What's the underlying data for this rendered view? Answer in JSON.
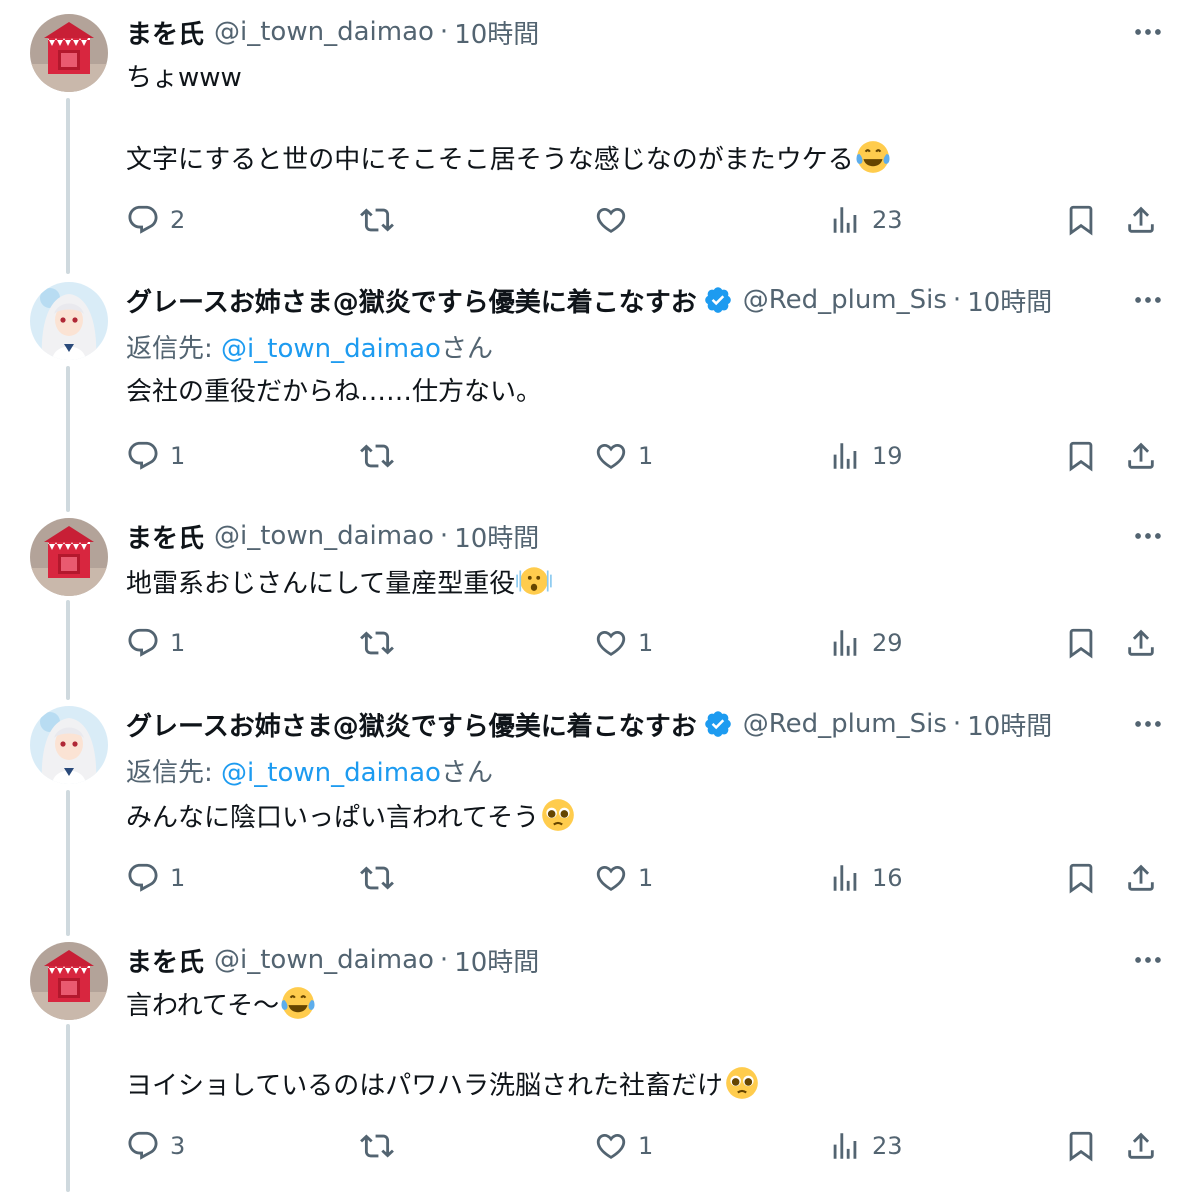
{
  "tweets": [
    {
      "author": "まを氏",
      "handle": "@i_town_daimao",
      "sep": "·",
      "time": "10時間",
      "verified": false,
      "avatar": "red-house-avatar",
      "lines": [
        "ちょwww",
        "",
        "文字にすると世の中にそこそこ居そうな感じなのがまたウケる"
      ],
      "line_emojis": [
        "",
        "",
        "laughing-crying-emoji"
      ],
      "replies": "2",
      "retweets": "",
      "likes": "",
      "views": "23"
    },
    {
      "author": "グレースお姉さま@獄炎ですら優美に着こなすお",
      "handle": "@Red_plum_Sis",
      "sep": "·",
      "time": "10時間",
      "verified": true,
      "avatar": "anime-girl-avatar",
      "reply_to_prefix": "返信先: ",
      "reply_to_user": "@i_town_daimao",
      "reply_to_suffix": "さん",
      "lines": [
        "会社の重役だからね……仕方ない。"
      ],
      "line_emojis": [
        ""
      ],
      "replies": "1",
      "retweets": "",
      "likes": "1",
      "views": "19"
    },
    {
      "author": "まを氏",
      "handle": "@i_town_daimao",
      "sep": "·",
      "time": "10時間",
      "verified": false,
      "avatar": "red-house-avatar",
      "lines": [
        "地雷系おじさんにして量産型重役"
      ],
      "line_emojis": [
        "shaking-face-emoji"
      ],
      "replies": "1",
      "retweets": "",
      "likes": "1",
      "views": "29"
    },
    {
      "author": "グレースお姉さま@獄炎ですら優美に着こなすお",
      "handle": "@Red_plum_Sis",
      "sep": "·",
      "time": "10時間",
      "verified": true,
      "avatar": "anime-girl-avatar",
      "reply_to_prefix": "返信先: ",
      "reply_to_user": "@i_town_daimao",
      "reply_to_suffix": "さん",
      "lines": [
        "みんなに陰口いっぱい言われてそう"
      ],
      "line_emojis": [
        "pleading-face-emoji"
      ],
      "replies": "1",
      "retweets": "",
      "likes": "1",
      "views": "16"
    },
    {
      "author": "まを氏",
      "handle": "@i_town_daimao",
      "sep": "·",
      "time": "10時間",
      "verified": false,
      "avatar": "red-house-avatar",
      "lines": [
        "言われてそ〜",
        "",
        "ヨイショしているのはパワハラ洗脳された社畜だけ"
      ],
      "line_emojis": [
        "laughing-crying-emoji",
        "",
        "pleading-face-emoji"
      ],
      "replies": "3",
      "retweets": "",
      "likes": "1",
      "views": "23"
    }
  ],
  "colors": {
    "text": "#0f1419",
    "secondary": "#536471",
    "link": "#1d9bf0",
    "verified": "#1d9bf0",
    "thread_line": "#cfd9de"
  }
}
